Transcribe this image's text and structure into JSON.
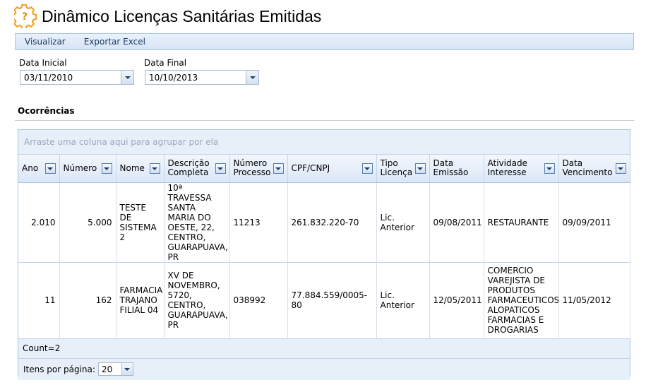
{
  "header": {
    "title": "Dinâmico Licenças Sanitárias Emitidas",
    "icon": "gear-question-icon",
    "icon_color": "#f0a020"
  },
  "menu": {
    "items": [
      "Visualizar",
      "Exportar Excel"
    ]
  },
  "filters": {
    "start": {
      "label": "Data Inicial",
      "value": "03/11/2010"
    },
    "end": {
      "label": "Data Final",
      "value": "10/10/2013"
    }
  },
  "section": {
    "title": "Ocorrências"
  },
  "grid": {
    "group_hint": "Arraste uma coluna aqui para agrupar por ela",
    "columns": [
      "Ano",
      "Número",
      "Nome",
      "Descrição Completa",
      "Número Processo",
      "CPF/CNPJ",
      "Tipo Licença",
      "Data Emissão",
      "Atividade Interesse",
      "Data Vencimento"
    ],
    "rows": [
      [
        "2.010",
        "5.000",
        "TESTE DE SISTEMA 2",
        "10ª TRAVESSA SANTA MARIA DO OESTE, 22, CENTRO, GUARAPUAVA, PR",
        "11213",
        "261.832.220-70",
        "Lic. Anterior",
        "09/08/2011",
        "RESTAURANTE",
        "09/09/2011"
      ],
      [
        "11",
        "162",
        "FARMACIA TRAJANO FILIAL 04",
        "XV DE NOVEMBRO, 5720, CENTRO, GUARAPUAVA, PR",
        "038992",
        "77.884.559/0005-80",
        "Lic. Anterior",
        "12/05/2011",
        "COMERCIO VAREJISTA DE PRODUTOS FARMACEUTICOS ALOPATICOS FARMACIAS E DROGARIAS",
        "11/05/2012"
      ]
    ],
    "count_text": "Count=2",
    "pager": {
      "label": "Itens por página:",
      "value": "20"
    }
  }
}
